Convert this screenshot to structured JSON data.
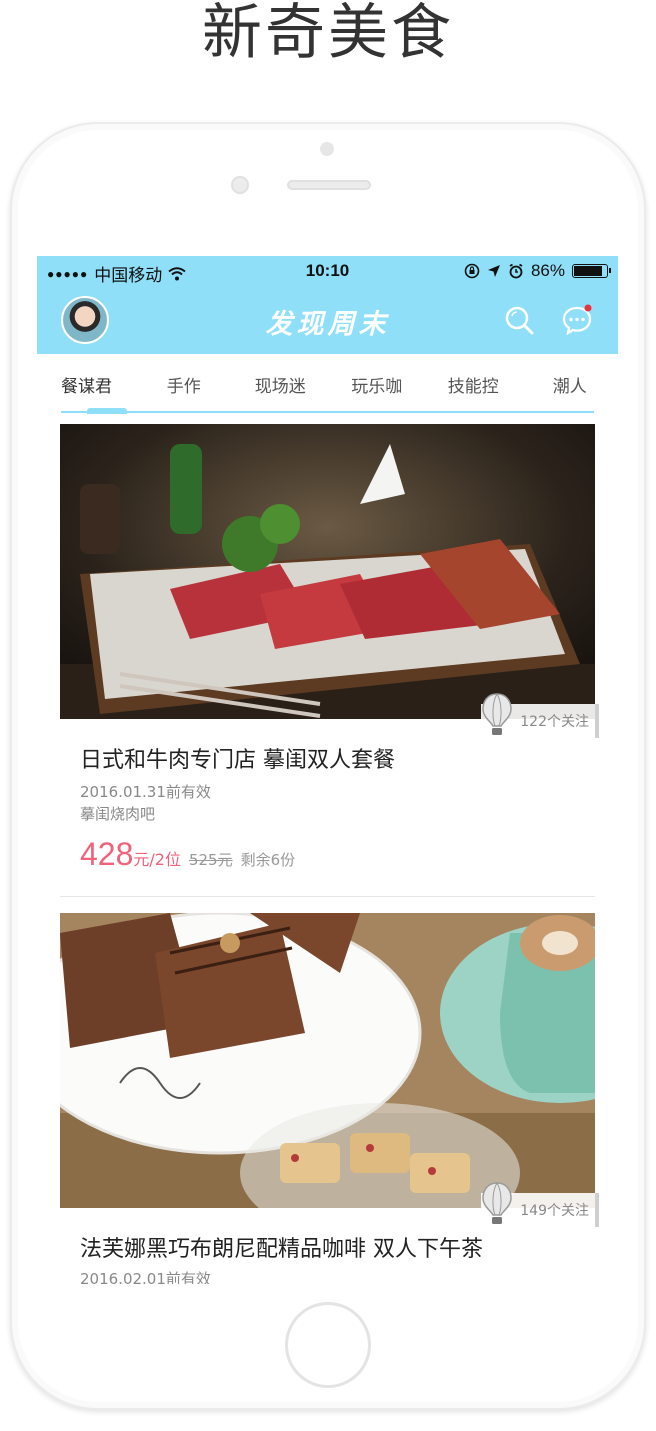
{
  "promo": {
    "title": "新奇美食"
  },
  "status_bar": {
    "carrier": "中国移动",
    "time": "10:10",
    "battery": "86%",
    "battery_level": 0.86
  },
  "navbar": {
    "title": "发现周末"
  },
  "tabs": [
    {
      "label": "餐谋君"
    },
    {
      "label": "手作"
    },
    {
      "label": "现场迷"
    },
    {
      "label": "玩乐咖"
    },
    {
      "label": "技能控"
    },
    {
      "label": "潮人"
    }
  ],
  "cards": [
    {
      "title": "日式和牛肉专门店 摹闺双人套餐",
      "date": "2016.01.31前有效",
      "shop": "摹闺烧肉吧",
      "price": "428",
      "price_unit": "元/2位",
      "original_price": "525元",
      "remaining": "剩余6份",
      "followers": "122个关注"
    },
    {
      "title": "法芙娜黑巧布朗尼配精品咖啡 双人下午茶",
      "date": "2016.02.01前有效",
      "followers": "149个关注"
    }
  ],
  "colors": {
    "accent": "#8fdff8",
    "price": "#f0627a"
  }
}
